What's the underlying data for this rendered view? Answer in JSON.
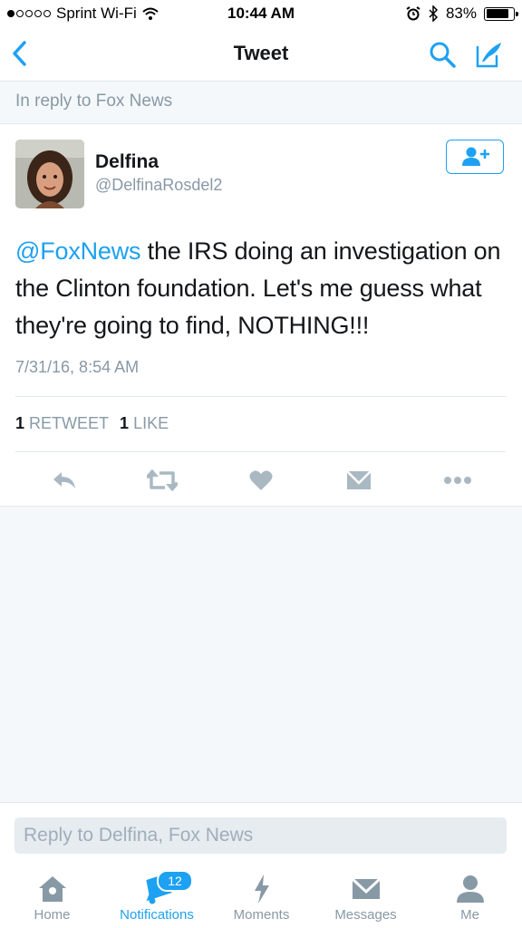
{
  "status_bar": {
    "carrier": "Sprint Wi-Fi",
    "time": "10:44 AM",
    "battery": "83%",
    "battery_level": 0.83
  },
  "nav": {
    "title": "Tweet"
  },
  "reply_banner": "In reply to Fox News",
  "tweet": {
    "name": "Delfina",
    "handle": "@DelfinaRosdel2",
    "mention": "@FoxNews",
    "text": " the IRS doing an investigation on the Clinton foundation. Let's me guess what they're going to find, NOTHING!!!",
    "timestamp": "7/31/16, 8:54 AM",
    "retweet_count": "1",
    "retweet_label": "RETWEET",
    "like_count": "1",
    "like_label": "LIKE"
  },
  "reply": {
    "placeholder": "Reply to Delfina, Fox News"
  },
  "tabs": [
    {
      "label": "Home",
      "icon": "home-icon"
    },
    {
      "label": "Notifications",
      "icon": "bell-icon",
      "badge": "12"
    },
    {
      "label": "Moments",
      "icon": "lightning-icon"
    },
    {
      "label": "Messages",
      "icon": "envelope-icon"
    },
    {
      "label": "Me",
      "icon": "person-icon"
    }
  ],
  "colors": {
    "accent": "#1da1f2",
    "muted": "#8899a6",
    "icon_gray": "#aab8c2"
  }
}
